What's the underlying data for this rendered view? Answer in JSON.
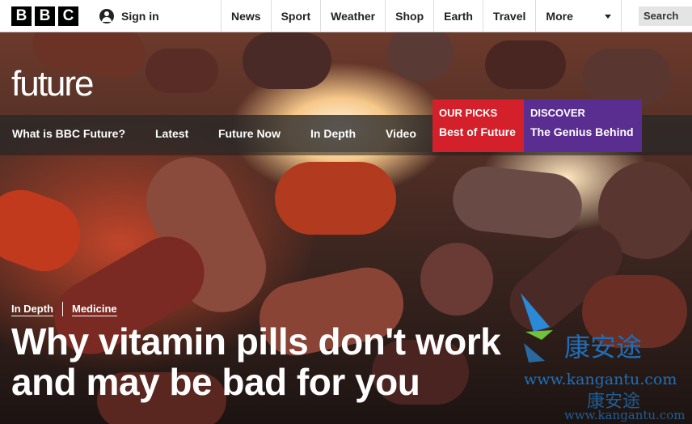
{
  "bbc_logo": [
    "B",
    "B",
    "C"
  ],
  "account": {
    "icon": "user-icon",
    "label": "Sign in"
  },
  "top_nav": [
    "News",
    "Sport",
    "Weather",
    "Shop",
    "Earth",
    "Travel"
  ],
  "more": {
    "label": "More",
    "icon": "chevron-down-icon"
  },
  "search": {
    "label": "Search"
  },
  "section_logo": "future",
  "sub_nav": [
    "What is BBC Future?",
    "Latest",
    "Future Now",
    "In Depth",
    "Video"
  ],
  "promos": [
    {
      "kicker": "OUR PICKS",
      "title": "Best of Future",
      "color": "#d4202a"
    },
    {
      "kicker": "DISCOVER",
      "title": "The Genius Behind",
      "color": "#5a2d91"
    }
  ],
  "article": {
    "tags": [
      "In Depth",
      "Medicine"
    ],
    "headline_line1": "Why vitamin pills don't work",
    "headline_line2": "and may be bad for you"
  },
  "watermark": {
    "chinese": "康安途",
    "url": "www.kangantu.com"
  }
}
